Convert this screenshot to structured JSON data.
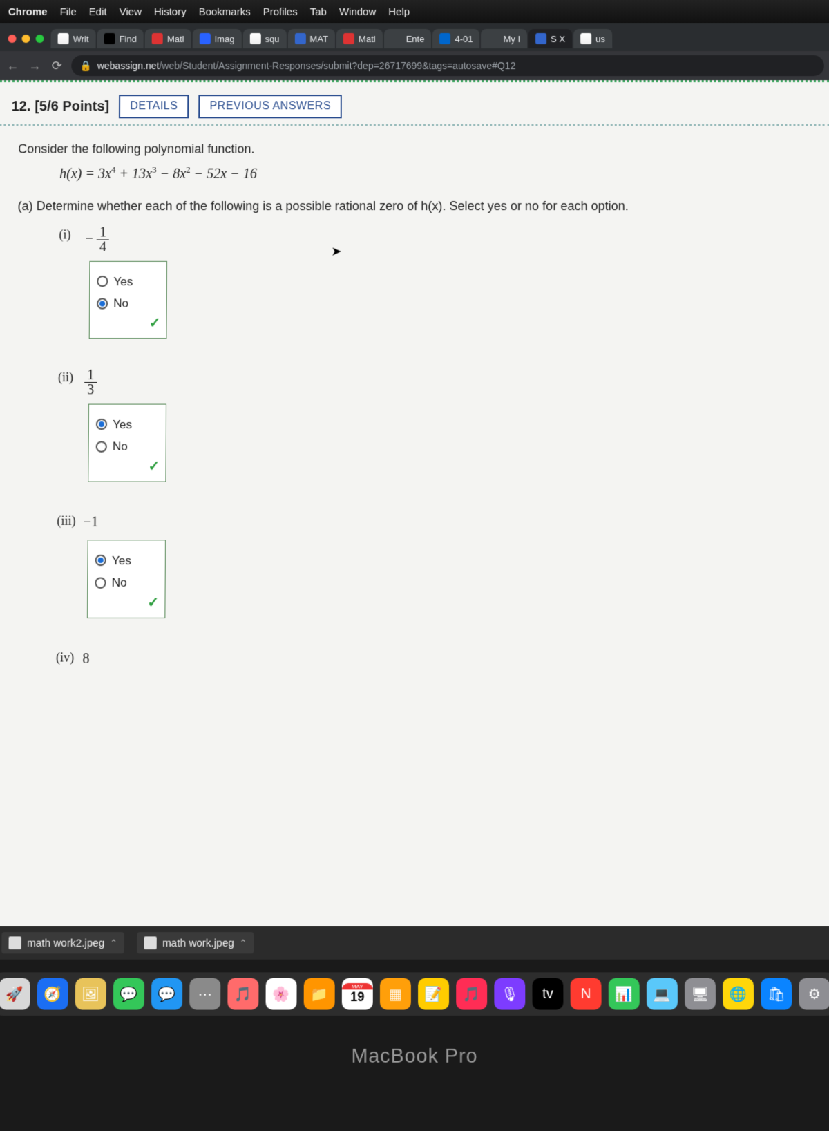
{
  "menubar": {
    "app": "Chrome",
    "items": [
      "File",
      "Edit",
      "View",
      "History",
      "Bookmarks",
      "Profiles",
      "Tab",
      "Window",
      "Help"
    ]
  },
  "tabs": [
    {
      "label": "Writ",
      "fav": "fav-g"
    },
    {
      "label": "Find",
      "fav": "fav-x"
    },
    {
      "label": "Matl",
      "fav": "fav-m"
    },
    {
      "label": "Imag",
      "fav": "fav-b"
    },
    {
      "label": "squ",
      "fav": "fav-g"
    },
    {
      "label": "MAT",
      "fav": "fav-w"
    },
    {
      "label": "Matl",
      "fav": "fav-m"
    },
    {
      "label": "Ente",
      "fav": ""
    },
    {
      "label": "4-01",
      "fav": "fav-o"
    },
    {
      "label": "My I",
      "fav": ""
    },
    {
      "label": "S X",
      "fav": "fav-w",
      "active": true
    },
    {
      "label": "us",
      "fav": "fav-g"
    }
  ],
  "url": {
    "domain": "webassign.net",
    "path": "/web/Student/Assignment-Responses/submit?dep=26717699&tags=autosave#Q12"
  },
  "question": {
    "number": "12.",
    "points": "[5/6 Points]",
    "details_btn": "DETAILS",
    "prev_btn": "PREVIOUS ANSWERS",
    "intro": "Consider the following polynomial function.",
    "formula_lhs": "h(x) = ",
    "formula_rhs": "3x⁴ + 13x³ − 8x² − 52x − 16",
    "partA": "(a)  Determine whether each of the following is a possible rational zero of h(x). Select yes or no for each option.",
    "yes": "Yes",
    "no": "No",
    "opts": [
      {
        "lbl": "(i)",
        "display": "neg_frac",
        "num": "1",
        "den": "4",
        "selected": "No",
        "correct": true
      },
      {
        "lbl": "(ii)",
        "display": "frac",
        "num": "1",
        "den": "3",
        "selected": "Yes",
        "correct": true
      },
      {
        "lbl": "(iii)",
        "display": "int",
        "val": "−1",
        "selected": "Yes",
        "correct": true
      },
      {
        "lbl": "(iv)",
        "display": "int",
        "val": "8",
        "selected": "",
        "correct": false
      }
    ]
  },
  "downloads": [
    {
      "name": "math work2.jpeg"
    },
    {
      "name": "math work.jpeg"
    }
  ],
  "dock": {
    "cal_month": "MAY",
    "cal_day": "19",
    "apps": [
      {
        "c": "#d8d8d8",
        "e": "🚀"
      },
      {
        "c": "#1b6ef3",
        "e": "🧭"
      },
      {
        "c": "#e8c35a",
        "e": "🖼"
      },
      {
        "c": "#34c759",
        "e": "💬"
      },
      {
        "c": "#2196f3",
        "e": "💬"
      },
      {
        "c": "#8a8a8a",
        "e": "⋯"
      },
      {
        "c": "#ff6b6b",
        "e": "🎵"
      },
      {
        "c": "#fff",
        "e": "🌸"
      },
      {
        "c": "#ff9500",
        "e": "📁"
      },
      {
        "c": "#fff",
        "e": "📅"
      },
      {
        "c": "#ff9f0a",
        "e": "▦"
      },
      {
        "c": "#ffcc00",
        "e": "📝"
      },
      {
        "c": "#ff2d55",
        "e": "🎵"
      },
      {
        "c": "#7d3cff",
        "e": "🎙"
      },
      {
        "c": "#000",
        "e": "tv"
      },
      {
        "c": "#ff3b30",
        "e": "N"
      },
      {
        "c": "#34c759",
        "e": "📊"
      },
      {
        "c": "#5ac8fa",
        "e": "💻"
      },
      {
        "c": "#8e8e93",
        "e": "🖥"
      },
      {
        "c": "#ffd60a",
        "e": "🌐"
      },
      {
        "c": "#0a84ff",
        "e": "🛍"
      },
      {
        "c": "#8e8e93",
        "e": "⚙"
      }
    ]
  },
  "bezel": "MacBook Pro"
}
